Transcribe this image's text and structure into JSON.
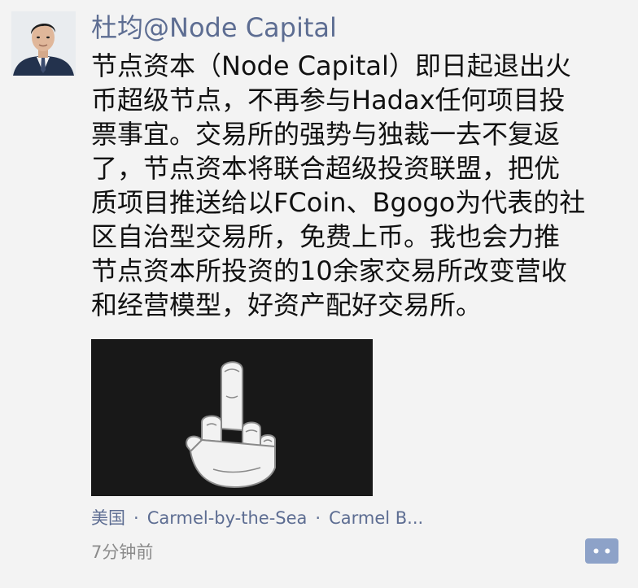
{
  "post": {
    "author": "杜均@Node Capital",
    "body_lines": [
      "节点资本（Node Capital）即日起退出火",
      "币超级节点，不再参与Hadax任何项目投",
      "票事宜。交易所的强势与独裁一去不复返",
      "了，节点资本将联合超级投资联盟，把优",
      "质项目推送给以FCoin、Bgogo为代表的社",
      "区自治型交易所，免费上币。我也会力推",
      "节点资本所投资的10余家交易所改变营收",
      "和经营模型，好资产配好交易所。"
    ],
    "location": {
      "country": "美国",
      "city": "Carmel-by-the-Sea",
      "place": "Carmel B...",
      "separator": "·"
    },
    "timestamp": "7分钟前"
  },
  "icons": {
    "avatar": "avatar-photo",
    "media": "middle-finger-hand",
    "comment": "comment-bubble-icon"
  },
  "colors": {
    "background": "#f3f3f3",
    "author_link": "#5d6d92",
    "text": "#111111",
    "meta": "#8b8b8b",
    "comment_button": "#8da2c8"
  }
}
